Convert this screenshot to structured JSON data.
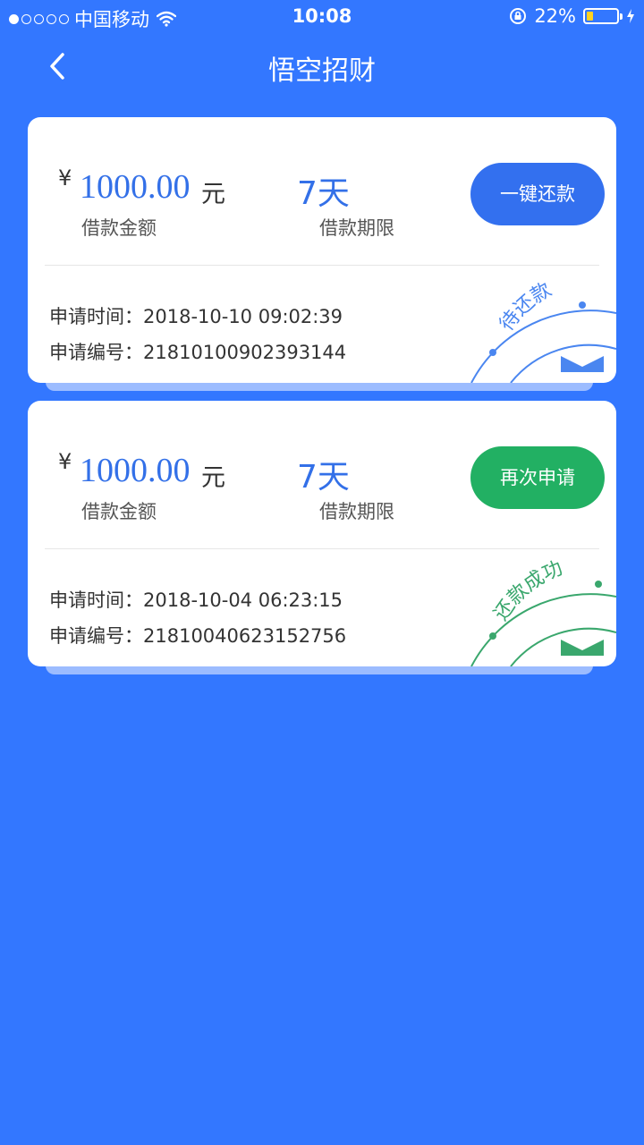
{
  "status_bar": {
    "carrier": "中国移动",
    "time": "10:08",
    "battery": "22%",
    "battery_level": 0.22
  },
  "nav": {
    "title": "悟空招财",
    "back_icon": "chevron-left-icon"
  },
  "colors": {
    "background": "#3377ff",
    "accent_blue": "#3370e8",
    "accent_green": "#22b063"
  },
  "loans": [
    {
      "currency_symbol": "¥",
      "amount": "1000.00",
      "amount_unit": "元",
      "amount_label": "借款金额",
      "term": "7天",
      "term_label": "借款期限",
      "action_label": "一键还款",
      "time_label": "申请时间：",
      "time_value": "2018-10-10 09:02:39",
      "number_label": "申请编号：",
      "number_value": "21810100902393144",
      "stamp_text": "待还款",
      "stamp_color": "#4a86f0"
    },
    {
      "currency_symbol": "¥",
      "amount": "1000.00",
      "amount_unit": "元",
      "amount_label": "借款金额",
      "term": "7天",
      "term_label": "借款期限",
      "action_label": "再次申请",
      "time_label": "申请时间：",
      "time_value": "2018-10-04 06:23:15",
      "number_label": "申请编号：",
      "number_value": "21810040623152756",
      "stamp_text": "还款成功",
      "stamp_color": "#3aa76d"
    }
  ]
}
